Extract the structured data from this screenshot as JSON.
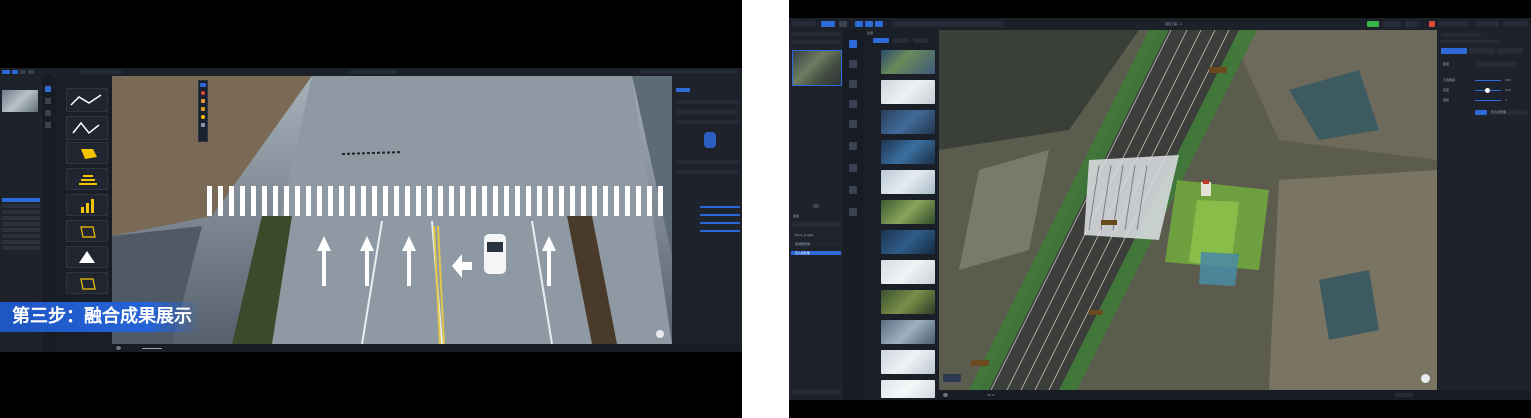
{
  "left": {
    "caption": "第三步：融合成果展示"
  },
  "right": {
    "window_title": "项目工程 - 1",
    "panels": {
      "layers": "图层",
      "resources": "资源"
    },
    "layer_items": [
      "terra_png3a",
      "多视角影像",
      "无人机影像"
    ],
    "right_panel": {
      "section_label": "图层",
      "props": [
        {
          "label": "不透明度",
          "value": "100"
        },
        {
          "label": "亮度",
          "value": "120"
        },
        {
          "label": "饱和",
          "value": "1"
        }
      ],
      "action_button": "无人机影像"
    },
    "scale_text": "20 m"
  },
  "colors": {
    "accent": "#2f6bd8",
    "caption_bg": "#1e56c2",
    "active_green": "#39b54a"
  }
}
